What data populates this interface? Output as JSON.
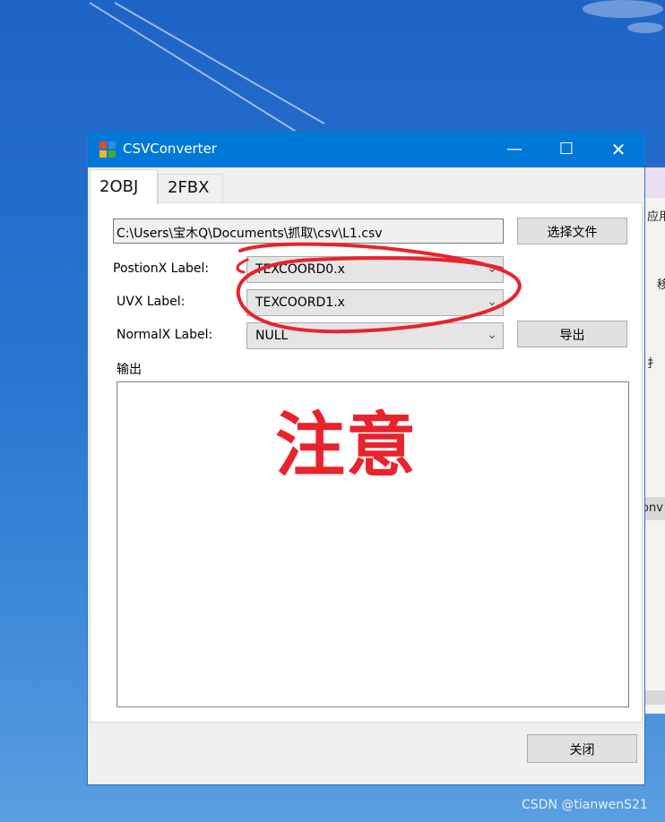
{
  "window": {
    "title": "CSVConverter",
    "minimize_label": "—",
    "maximize_label": "☐",
    "close_label": "✕"
  },
  "tabs": [
    {
      "label": "2OBJ",
      "active": true
    },
    {
      "label": "2FBX",
      "active": false
    }
  ],
  "form": {
    "file_path": "C:\\Users\\宝木Q\\Documents\\抓取\\csv\\L1.csv",
    "choose_file_button": "选择文件",
    "position_label": "PostionX Label:",
    "position_value": "TEXCOORD0.x",
    "uv_label": "UVX Label:",
    "uv_value": "TEXCOORD1.x",
    "normal_label": "NormalX Label:",
    "normal_value": "NULL",
    "export_button": "导出",
    "output_label": "输出",
    "output_text": ""
  },
  "annotation": {
    "note": "注意",
    "color": "#e8232e"
  },
  "footer": {
    "close_button": "关闭"
  },
  "background_window": {
    "fragments": [
      "应用",
      "移",
      "扌",
      "onv"
    ]
  },
  "watermark": "CSDN @tianwenS21",
  "colors": {
    "titlebar": "#0078d7",
    "desktop": "#2a74cf"
  }
}
